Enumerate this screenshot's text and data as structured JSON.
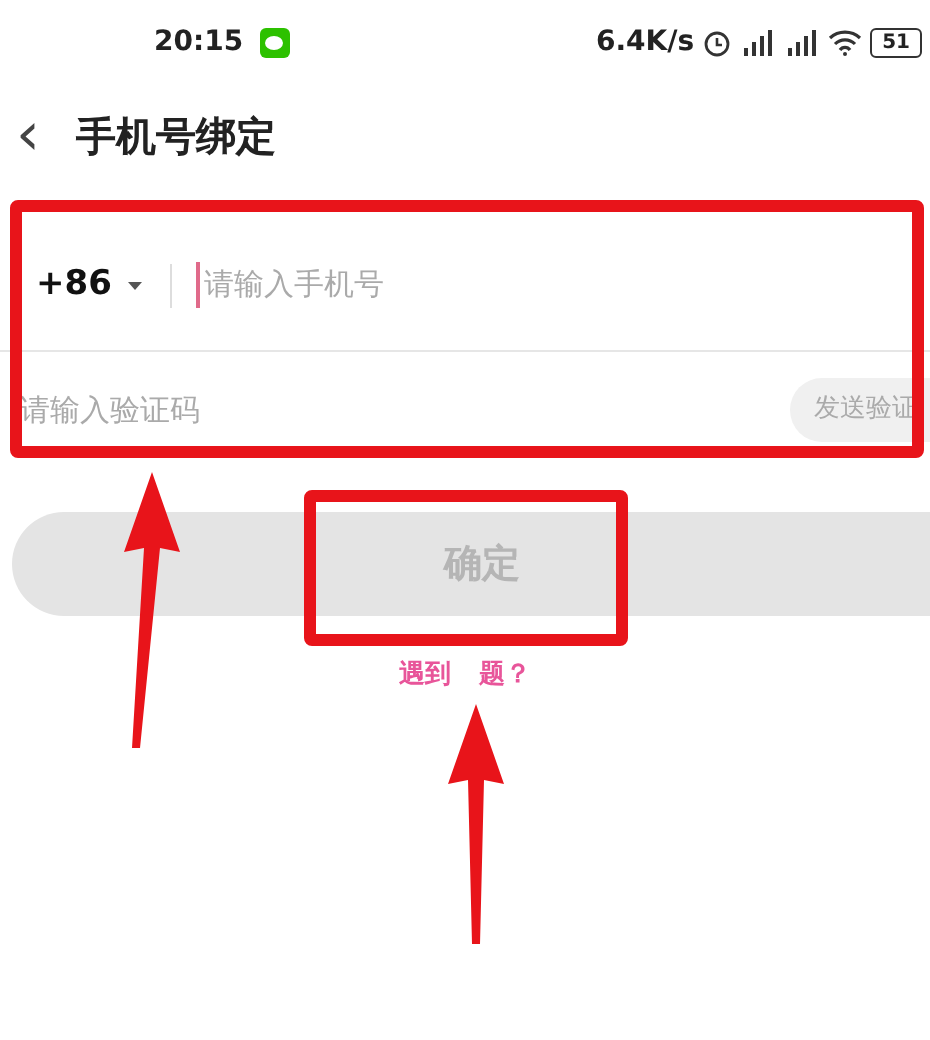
{
  "status_bar": {
    "time": "20:15",
    "network_speed": "6.4K/s",
    "battery": "51"
  },
  "header": {
    "back_icon": "‹",
    "title": "手机号绑定"
  },
  "phone_form": {
    "country_code": "+86",
    "phone_placeholder": "请输入手机号",
    "code_placeholder": "请输入验证码",
    "send_code_button": "发送验证"
  },
  "confirm_button": {
    "label": "确定",
    "disabled": true
  },
  "help_link": {
    "text_before": "遇到",
    "text_after": "题？"
  }
}
